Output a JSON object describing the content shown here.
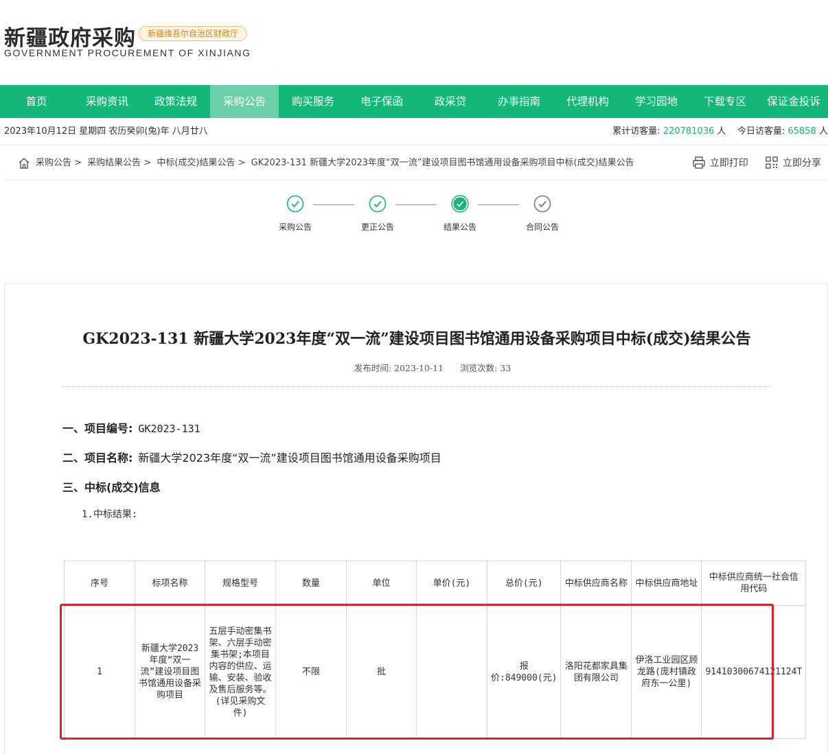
{
  "header": {
    "logo_cn": "新疆政府采购",
    "badge": "新疆维吾尔自治区财政厅",
    "logo_en": "GOVERNMENT PROCUREMENT OF XINJIANG"
  },
  "nav": [
    {
      "label": "首页"
    },
    {
      "label": "采购资讯"
    },
    {
      "label": "政策法规"
    },
    {
      "label": "采购公告",
      "active": true
    },
    {
      "label": "购买服务"
    },
    {
      "label": "电子保函"
    },
    {
      "label": "政采贷"
    },
    {
      "label": "办事指南"
    },
    {
      "label": "代理机构"
    },
    {
      "label": "学习园地"
    },
    {
      "label": "下载专区"
    },
    {
      "label": "保证金投诉"
    }
  ],
  "datebar": {
    "date": "2023年10月12日 星期四 农历癸卯(兔)年 八月廿八",
    "total_label": "累计访客量:",
    "total_value": "220781036",
    "total_unit": "人",
    "today_label": "今日访客量:",
    "today_value": "65858",
    "today_unit": "人"
  },
  "breadcrumb": {
    "items": [
      "采购公告 >",
      "采购结果公告 >",
      "中标(成交)结果公告 >",
      "GK2023-131 新疆大学2023年度“双一流”建设项目图书馆通用设备采购项目中标(成交)结果公告"
    ],
    "print": "立即打印",
    "share": "立即分享"
  },
  "steps": [
    {
      "label": "采购公告",
      "state": "done"
    },
    {
      "label": "更正公告",
      "state": "done"
    },
    {
      "label": "结果公告",
      "state": "current"
    },
    {
      "label": "合同公告",
      "state": "pending"
    }
  ],
  "article": {
    "title": "GK2023-131 新疆大学2023年度“双一流”建设项目图书馆通用设备采购项目中标(成交)结果公告",
    "publish_label": "发布时间: 2023-10-11",
    "views_label": "浏览次数: 33",
    "sec1_label": "一、项目编号:",
    "sec1_value": "GK2023-131",
    "sec2_label": "二、项目名称:",
    "sec2_value": "新疆大学2023年度“双一流”建设项目图书馆通用设备采购项目",
    "sec3_label": "三、中标(成交)信息",
    "sub1": "1.中标结果:"
  },
  "table": {
    "headers": [
      "序号",
      "标项名称",
      "规格型号",
      "数量",
      "单位",
      "单价(元)",
      "总价(元)",
      "中标供应商名称",
      "中标供应商地址",
      "中标供应商统一社会信用代码"
    ],
    "rows": [
      [
        "1",
        "新疆大学2023年度“双一流”建设项目图书馆通用设备采购项目",
        "五层手动密集书架、六层手动密集书架;本项目内容的供应、运输、安装、验收及售后服务等。(详见采购文件)",
        "不限",
        "批",
        "",
        "报价:849000(元)",
        "洛阳花都家具集团有限公司",
        "伊洛工业园区顾龙路(庞村镇政府东一公里)",
        "91410300674121124T"
      ]
    ]
  },
  "colors": {
    "brand_green": "#13b778",
    "nav_active": "#6bd0a8",
    "highlight_red": "#e0202a"
  }
}
